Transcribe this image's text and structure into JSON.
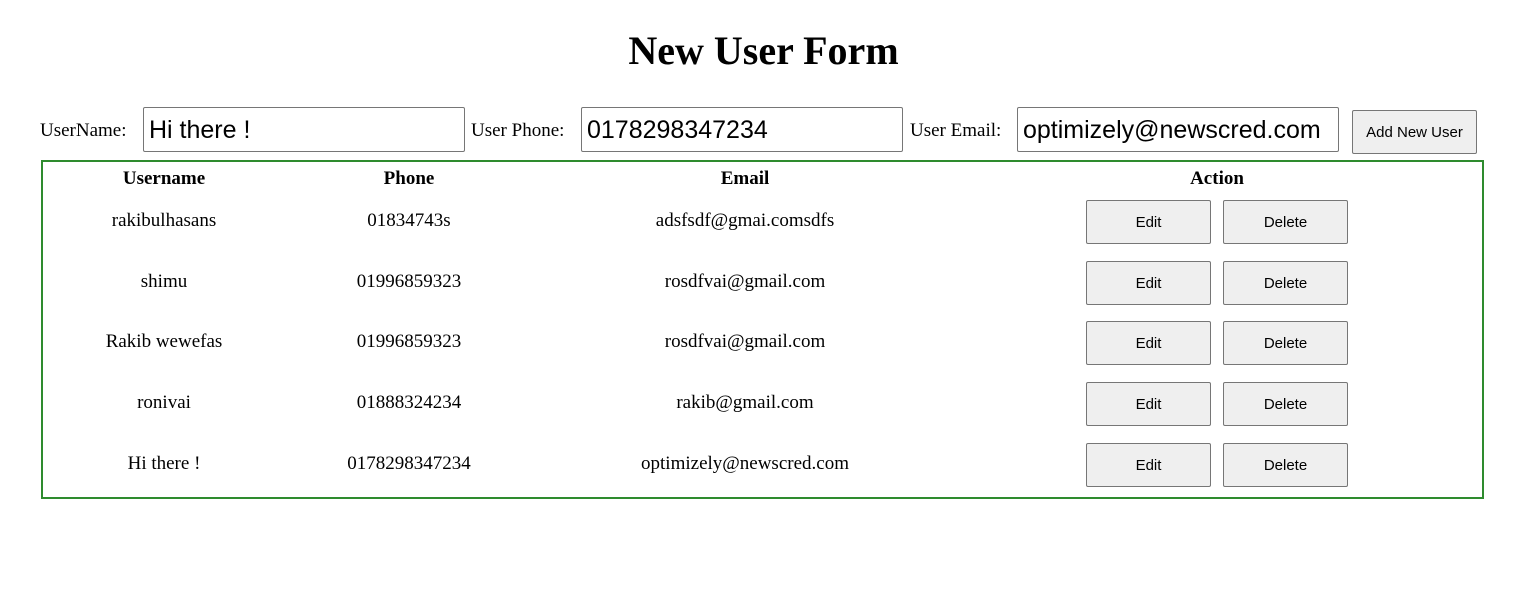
{
  "page": {
    "title": "New User Form"
  },
  "form": {
    "username_label": "UserName:",
    "username_value": "Hi there !",
    "phone_label": "User Phone:",
    "phone_value": "0178298347234",
    "email_label": "User Email:",
    "email_value": "optimizely@newscred.com",
    "add_button": "Add New User"
  },
  "table": {
    "headers": {
      "username": "Username",
      "phone": "Phone",
      "email": "Email",
      "action": "Action"
    },
    "rows": [
      {
        "username": "rakibulhasans",
        "phone": "01834743s",
        "email": "adsfsdf@gmai.comsdfs",
        "edit": "Edit",
        "delete": "Delete"
      },
      {
        "username": "shimu",
        "phone": "01996859323",
        "email": "rosdfvai@gmail.com",
        "edit": "Edit",
        "delete": "Delete"
      },
      {
        "username": "Rakib wewefas",
        "phone": "01996859323",
        "email": "rosdfvai@gmail.com",
        "edit": "Edit",
        "delete": "Delete"
      },
      {
        "username": "ronivai",
        "phone": "01888324234",
        "email": "rakib@gmail.com",
        "edit": "Edit",
        "delete": "Delete"
      },
      {
        "username": "Hi there !",
        "phone": "0178298347234",
        "email": "optimizely@newscred.com",
        "edit": "Edit",
        "delete": "Delete"
      }
    ]
  },
  "colors": {
    "table_border": "#2e8b2e",
    "button_bg": "#efefef",
    "input_border": "#767676"
  }
}
